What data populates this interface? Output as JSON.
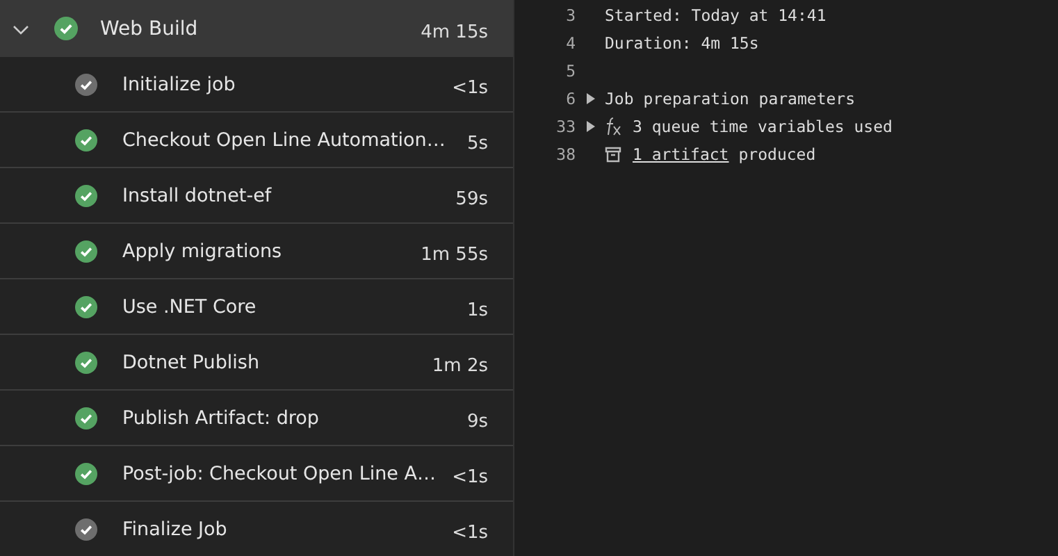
{
  "job": {
    "title": "Web Build",
    "duration": "4m 15s",
    "color": "#55a362",
    "expanded": true
  },
  "steps": [
    {
      "name": "Initialize job",
      "duration": "<1s",
      "color": "#6e6e6e"
    },
    {
      "name": "Checkout Open Line Automation…",
      "duration": "5s",
      "color": "#55a362"
    },
    {
      "name": "Install dotnet-ef",
      "duration": "59s",
      "color": "#55a362"
    },
    {
      "name": "Apply migrations",
      "duration": "1m 55s",
      "color": "#55a362"
    },
    {
      "name": "Use .NET Core",
      "duration": "1s",
      "color": "#55a362"
    },
    {
      "name": "Dotnet Publish",
      "duration": "1m 2s",
      "color": "#55a362"
    },
    {
      "name": "Publish Artifact: drop",
      "duration": "9s",
      "color": "#55a362"
    },
    {
      "name": "Post-job: Checkout Open Line A…",
      "duration": "<1s",
      "color": "#55a362"
    },
    {
      "name": "Finalize Job",
      "duration": "<1s",
      "color": "#6e6e6e"
    }
  ],
  "log": [
    {
      "line": "3",
      "text": "Started: Today at 14:41"
    },
    {
      "line": "4",
      "text": "Duration: 4m 15s"
    },
    {
      "line": "5"
    },
    {
      "line": "6",
      "expandable": true,
      "text": "Job preparation parameters"
    },
    {
      "line": "33",
      "expandable": true,
      "kind": "variables",
      "text": "3 queue time variables used"
    },
    {
      "line": "38",
      "kind": "artifact",
      "link": "1 artifact",
      "text": "produced"
    }
  ]
}
